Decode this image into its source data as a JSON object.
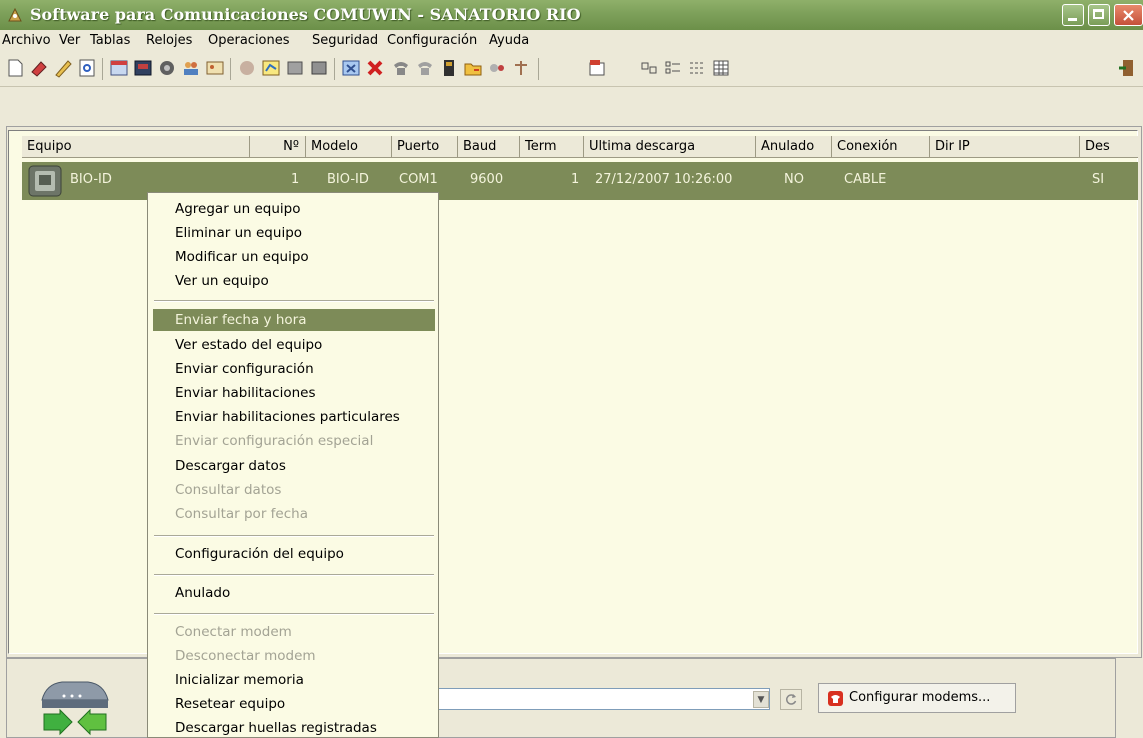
{
  "window": {
    "title": "Software para Comunicaciones COMUWIN - SANATORIO RIO"
  },
  "menubar": [
    "Archivo",
    "Ver",
    "Tablas",
    "Relojes",
    "Operaciones",
    "Seguridad",
    "Configuración",
    "Ayuda"
  ],
  "table": {
    "columns": [
      "Equipo",
      "Nº",
      "Modelo",
      "Puerto",
      "Baud",
      "Term",
      "Ultima descarga",
      "Anulado",
      "Conexión",
      "Dir IP",
      "Des"
    ],
    "rows": [
      {
        "equipo": "BIO-ID",
        "num": "1",
        "modelo": "BIO-ID",
        "puerto": "COM1",
        "baud": "9600",
        "term": "1",
        "ultima_descarga": "27/12/2007 10:26:00",
        "anulado": "NO",
        "conexion": "CABLE",
        "dir_ip": "",
        "des": "SI"
      }
    ]
  },
  "context_menu": {
    "items": [
      {
        "label": "Agregar un equipo",
        "enabled": true
      },
      {
        "label": "Eliminar un equipo",
        "enabled": true
      },
      {
        "label": "Modificar un equipo",
        "enabled": true
      },
      {
        "label": "Ver un equipo",
        "enabled": true
      },
      {
        "label": "Enviar fecha y hora",
        "enabled": true,
        "highlighted": true
      },
      {
        "label": "Ver estado del equipo",
        "enabled": true
      },
      {
        "label": "Enviar configuración",
        "enabled": true
      },
      {
        "label": "Enviar habilitaciones",
        "enabled": true
      },
      {
        "label": "Enviar habilitaciones particulares",
        "enabled": true
      },
      {
        "label": "Enviar configuración especial",
        "enabled": false
      },
      {
        "label": "Descargar datos",
        "enabled": true
      },
      {
        "label": "Consultar datos",
        "enabled": false
      },
      {
        "label": "Consultar por fecha",
        "enabled": false
      },
      {
        "label": "Configuración del equipo",
        "enabled": true
      },
      {
        "label": "Anulado",
        "enabled": true
      },
      {
        "label": "Conectar modem",
        "enabled": false
      },
      {
        "label": "Desconectar modem",
        "enabled": false
      },
      {
        "label": "Inicializar memoria",
        "enabled": true
      },
      {
        "label": "Resetear equipo",
        "enabled": true
      },
      {
        "label": "Descargar huellas registradas",
        "enabled": true
      }
    ]
  },
  "bottom": {
    "configure_modems_label": "Configurar modems..."
  },
  "colors": {
    "title_bar": "#7da05a",
    "selection": "#7d8b58",
    "list_background": "#fbfbe4"
  }
}
